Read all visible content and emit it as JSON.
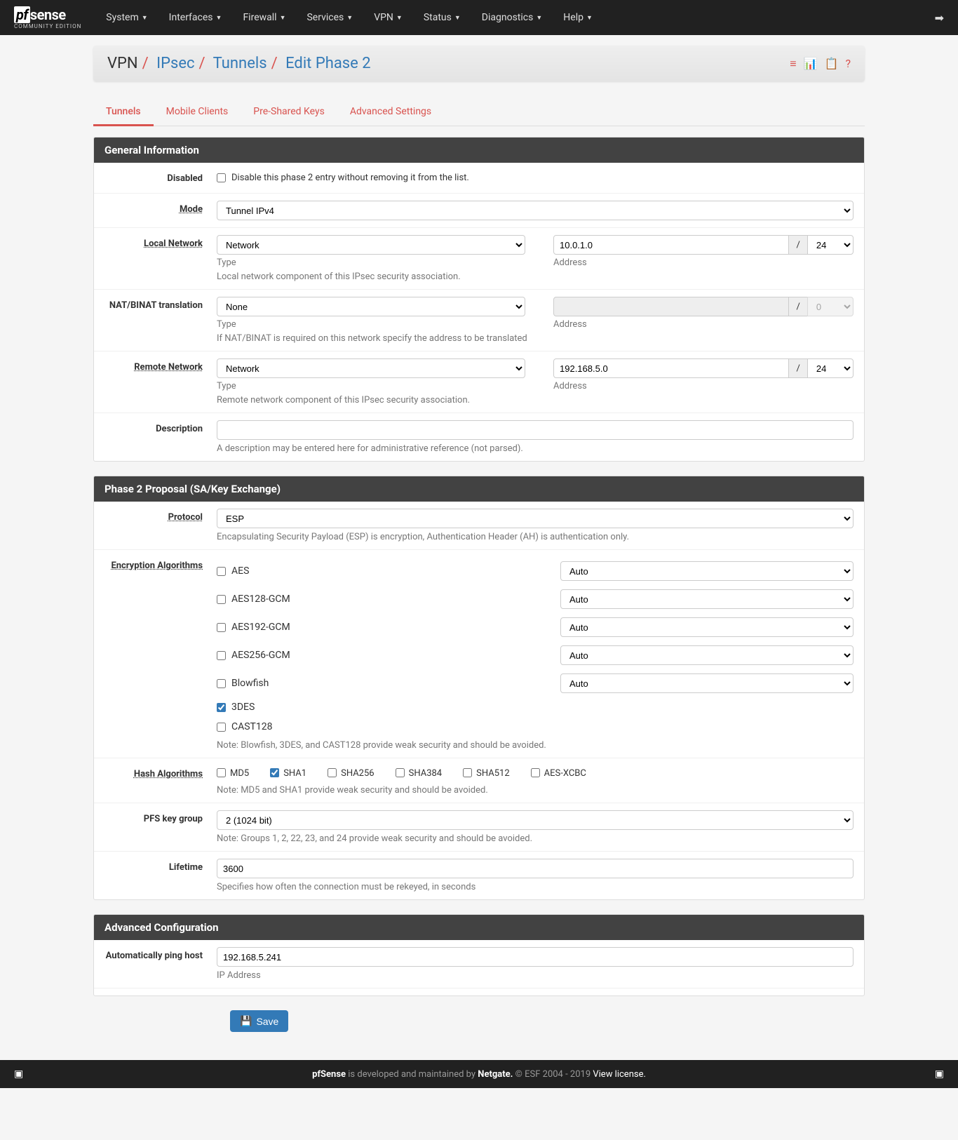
{
  "brand": {
    "name": "pfsense",
    "sub": "COMMUNITY EDITION"
  },
  "nav": [
    "System",
    "Interfaces",
    "Firewall",
    "Services",
    "VPN",
    "Status",
    "Diagnostics",
    "Help"
  ],
  "breadcrumb": {
    "root": "VPN",
    "b2": "IPsec",
    "b3": "Tunnels",
    "b4": "Edit Phase 2"
  },
  "tabs": {
    "t1": "Tunnels",
    "t2": "Mobile Clients",
    "t3": "Pre-Shared Keys",
    "t4": "Advanced Settings"
  },
  "panels": {
    "general": "General Information",
    "proposal": "Phase 2 Proposal (SA/Key Exchange)",
    "advanced": "Advanced Configuration"
  },
  "labels": {
    "disabled": "Disabled",
    "mode": "Mode",
    "local_net": "Local Network",
    "nat": "NAT/BINAT translation",
    "remote_net": "Remote Network",
    "desc": "Description",
    "protocol": "Protocol",
    "enc": "Encryption Algorithms",
    "hash": "Hash Algorithms",
    "pfs": "PFS key group",
    "lifetime": "Lifetime",
    "pinghost": "Automatically ping host",
    "type": "Type",
    "address": "Address"
  },
  "help": {
    "disabled": "Disable this phase 2 entry without removing it from the list.",
    "local_net": "Local network component of this IPsec security association.",
    "nat": "If NAT/BINAT is required on this network specify the address to be translated",
    "remote_net": "Remote network component of this IPsec security association.",
    "desc": "A description may be entered here for administrative reference (not parsed).",
    "protocol": "Encapsulating Security Payload (ESP) is encryption, Authentication Header (AH) is authentication only.",
    "enc_note": "Note: Blowfish, 3DES, and CAST128 provide weak security and should be avoided.",
    "hash_note": "Note: MD5 and SHA1 provide weak security and should be avoided.",
    "pfs_note": "Note: Groups 1, 2, 22, 23, and 24 provide weak security and should be avoided.",
    "lifetime": "Specifies how often the connection must be rekeyed, in seconds",
    "pinghost": "IP Address"
  },
  "values": {
    "mode": "Tunnel IPv4",
    "local_type": "Network",
    "local_addr": "10.0.1.0",
    "local_mask": "24",
    "nat_type": "None",
    "nat_addr": "",
    "nat_mask": "0",
    "remote_type": "Network",
    "remote_addr": "192.168.5.0",
    "remote_mask": "24",
    "desc": "",
    "protocol": "ESP",
    "auto": "Auto",
    "pfs": "2 (1024 bit)",
    "lifetime": "3600",
    "pinghost": "192.168.5.241"
  },
  "enc": {
    "aes": "AES",
    "aes128gcm": "AES128-GCM",
    "aes192gcm": "AES192-GCM",
    "aes256gcm": "AES256-GCM",
    "blowfish": "Blowfish",
    "des3": "3DES",
    "cast128": "CAST128"
  },
  "hash": {
    "md5": "MD5",
    "sha1": "SHA1",
    "sha256": "SHA256",
    "sha384": "SHA384",
    "sha512": "SHA512",
    "aesxcbc": "AES-XCBC"
  },
  "save": "Save",
  "footer": {
    "pre": "pfSense",
    "mid1": " is developed and maintained by ",
    "netgate": "Netgate.",
    "mid2": " © ESF 2004 - 2019 ",
    "link": "View license."
  }
}
